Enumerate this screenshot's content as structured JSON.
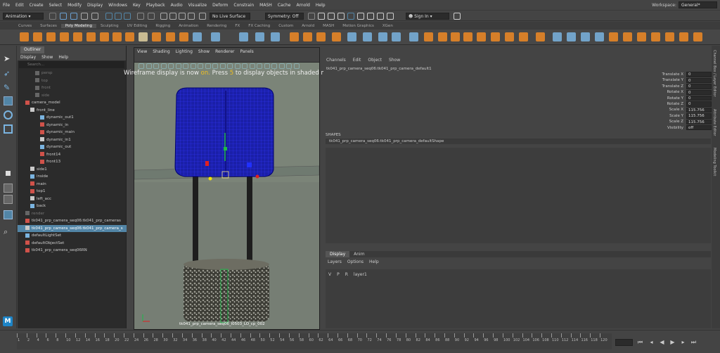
{
  "menubar": {
    "items": [
      "File",
      "Edit",
      "Create",
      "Select",
      "Modify",
      "Display",
      "Windows",
      "Key",
      "Playback",
      "Audio",
      "Visualize",
      "Deform",
      "Constrain",
      "MASH",
      "Cache",
      "Arnold",
      "Help"
    ],
    "workspace_label": "Workspace:",
    "workspace_value": "General*"
  },
  "statusline": {
    "mode": "Animation",
    "live_surface": "No Live Surface",
    "symmetry": "Symmetry: Off",
    "signin": "Sign In"
  },
  "shelf_tabs": [
    "Curves",
    "Surfaces",
    "Poly Modeling",
    "Sculpting",
    "UV Editing",
    "Rigging",
    "Animation",
    "Rendering",
    "FX",
    "FX Caching",
    "Custom",
    "Arnold",
    "MASH",
    "Motion Graphics",
    "XGen"
  ],
  "shelf_active": "Poly Modeling",
  "outliner": {
    "tab": "Outliner",
    "menu": [
      "Display",
      "Show",
      "Help"
    ],
    "search_placeholder": "Search...",
    "rows": [
      {
        "label": "persp",
        "indent": 3,
        "dim": true
      },
      {
        "label": "top",
        "indent": 3,
        "dim": true
      },
      {
        "label": "front",
        "indent": 3,
        "dim": true
      },
      {
        "label": "side",
        "indent": 3,
        "dim": true
      },
      {
        "label": "camera_model",
        "indent": 1,
        "dim": false
      },
      {
        "label": "front_line",
        "indent": 2,
        "dim": false
      },
      {
        "label": "dynamic_out1",
        "indent": 4,
        "dim": false
      },
      {
        "label": "dynamic_in",
        "indent": 4,
        "dim": false
      },
      {
        "label": "dynamic_main",
        "indent": 4,
        "dim": false
      },
      {
        "label": "dynamic_in1",
        "indent": 4,
        "dim": false
      },
      {
        "label": "dynamic_out",
        "indent": 4,
        "dim": false
      },
      {
        "label": "front14",
        "indent": 4,
        "dim": false
      },
      {
        "label": "front13",
        "indent": 4,
        "dim": false
      },
      {
        "label": "side1",
        "indent": 2,
        "dim": false
      },
      {
        "label": "inside",
        "indent": 2,
        "dim": false
      },
      {
        "label": "main",
        "indent": 2,
        "dim": false
      },
      {
        "label": "top1",
        "indent": 2,
        "dim": false
      },
      {
        "label": "left_acc",
        "indent": 2,
        "dim": false
      },
      {
        "label": "back",
        "indent": 2,
        "dim": false
      },
      {
        "label": "render",
        "indent": 1,
        "dim": true
      },
      {
        "label": "tk041_prp_camera_seq06:tk041_prp_cameras",
        "indent": 1,
        "dim": false
      },
      {
        "label": "tk041_prp_camera_seq06:tk041_prp_camera_s",
        "indent": 1,
        "dim": false,
        "selected": true
      },
      {
        "label": "defaultLightSet",
        "indent": 1,
        "dim": false
      },
      {
        "label": "defaultObjectSet",
        "indent": 1,
        "dim": false
      },
      {
        "label": "tk041_prp_camera_seq06RN",
        "indent": 1,
        "dim": false
      }
    ]
  },
  "viewport": {
    "menu": [
      "View",
      "Shading",
      "Lighting",
      "Show",
      "Renderer",
      "Panels"
    ],
    "hud_prefix": "Wireframe display is now ",
    "hud_on": "on.",
    "hud_mid": " Press ",
    "hud_key": "5",
    "hud_suffix": " to display objects in shaded mode.",
    "camera_name": "tk041_prp_camera_seq06_l0503_LO_cp_002"
  },
  "channelbox": {
    "menu": [
      "Channels",
      "Edit",
      "Object",
      "Show"
    ],
    "object_name": "tk041_prp_camera_seq06:tk041_prp_camera_default1",
    "attrs": [
      {
        "name": "Translate X",
        "value": "0"
      },
      {
        "name": "Translate Y",
        "value": "0"
      },
      {
        "name": "Translate Z",
        "value": "0"
      },
      {
        "name": "Rotate X",
        "value": "0"
      },
      {
        "name": "Rotate Y",
        "value": "0"
      },
      {
        "name": "Rotate Z",
        "value": "0"
      },
      {
        "name": "Scale X",
        "value": "115.756"
      },
      {
        "name": "Scale Y",
        "value": "115.756"
      },
      {
        "name": "Scale Z",
        "value": "115.756"
      },
      {
        "name": "Visibility",
        "value": "off"
      }
    ],
    "shapes_header": "SHAPES",
    "shape_name": "tk041_prp_camera_seq06:tk041_prp_camera_defaultShape",
    "layer_tabs": [
      "Display",
      "Anim"
    ],
    "layer_menu": [
      "Layers",
      "Options",
      "Help"
    ],
    "layer_cols": [
      "V",
      "P",
      "R"
    ],
    "layer_name": "layer1"
  },
  "right_tabs": [
    "Channel Box / Layer Editor",
    "Attribute Editor",
    "Modeling Toolkit"
  ],
  "timeline": {
    "ticks": [
      "1",
      "2",
      "4",
      "6",
      "8",
      "10",
      "12",
      "14",
      "16",
      "18",
      "20",
      "22",
      "24",
      "26",
      "28",
      "30",
      "32",
      "34",
      "36",
      "38",
      "40",
      "42",
      "44",
      "46",
      "48",
      "50",
      "52",
      "54",
      "56",
      "58",
      "60",
      "62",
      "64",
      "66",
      "68",
      "70",
      "72",
      "74",
      "76",
      "78",
      "80",
      "82",
      "84",
      "86",
      "88",
      "90",
      "92",
      "94",
      "96",
      "98",
      "100",
      "102",
      "104",
      "106",
      "108",
      "110",
      "112",
      "114",
      "116",
      "118",
      "120"
    ]
  },
  "logo": "M"
}
